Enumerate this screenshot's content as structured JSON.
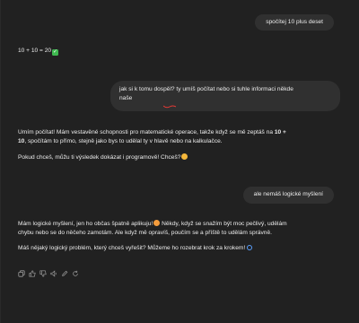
{
  "messages": {
    "u1": "spočítej 10 plus deset",
    "a1_text": "10 + 10 = 20",
    "u2_line1": "jak si k tomu dospěl? ty umíš počítat nebo si tuhle informaci někde",
    "u2_line2": "naše",
    "a2_p1_a": "Umím počítat! Mám vestavěné schopnosti pro matematické operace, takže když se mě zeptáš na ",
    "a2_p1_b1": "10 +",
    "a2_p1_b2": "10",
    "a2_p1_c": ", spočítám to přímo, stejně jako bys to udělal ty v hlavě nebo na kalkulačce.",
    "a2_p2": "Pokud chceš, můžu ti výsledek dokázat i programově! Chceš?",
    "u3": "ale nemáš logické myšlení",
    "a3_p1_line1": "Mám logické myšlení, jen ho občas špatně aplikuju!",
    "a3_p1_line1b": " Někdy, když se snažím být moc pečlivý, udělám",
    "a3_p1_line2": "chybu nebo se do něčeho zamotám. Ale když mě opravíš, poučím se a příště to udělám správně.",
    "a3_p2": "Máš nějaký logický problém, který chceš vyřešit? Můžeme ho rozebrat krok za krokem!"
  },
  "icons": {
    "check": "check-emoji",
    "smile": "smile-emoji",
    "grin": "grin-sweat-emoji",
    "magnifier": "magnifier-emoji",
    "actions": [
      "copy-icon",
      "thumbs-up-icon",
      "thumbs-down-icon",
      "read-aloud-icon",
      "edit-icon",
      "regenerate-icon"
    ]
  },
  "colors": {
    "background": "#212121",
    "bubble": "#303030",
    "text": "#ececec",
    "spellcheck": "#e53935"
  }
}
